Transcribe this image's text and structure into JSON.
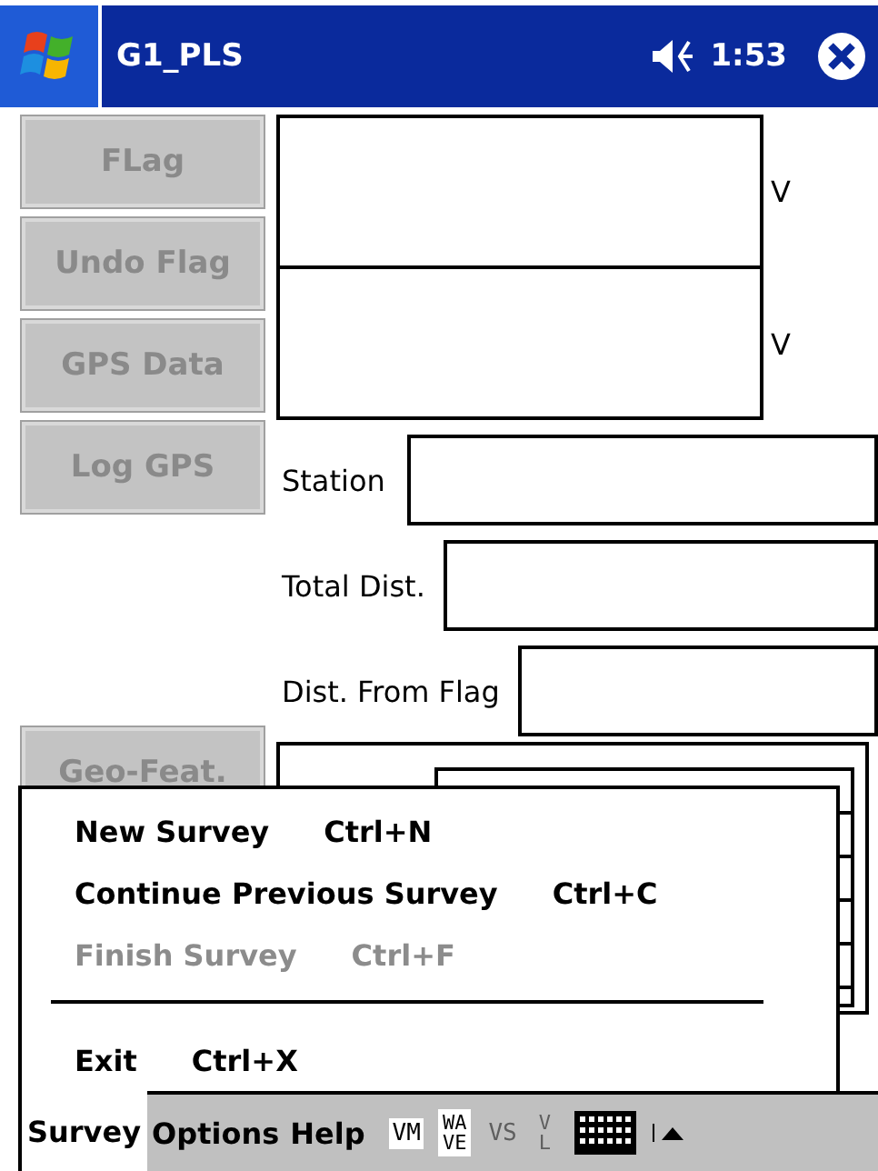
{
  "title_bar": {
    "title": "G1_PLS",
    "time": "1:53"
  },
  "side_buttons": [
    {
      "label": "FLag",
      "disabled": true
    },
    {
      "label": "Undo Flag",
      "disabled": true
    },
    {
      "label": "GPS Data",
      "disabled": true
    },
    {
      "label": "Log GPS",
      "disabled": true
    }
  ],
  "graphs": [
    {
      "unit": "V"
    },
    {
      "unit": "V"
    }
  ],
  "fields": [
    {
      "label": "Station"
    },
    {
      "label": "Total Dist."
    },
    {
      "label": "Dist. From Flag"
    }
  ],
  "geo_button": {
    "label": "Geo-Feat.",
    "disabled": true
  },
  "menu": {
    "items": [
      {
        "kind": "item",
        "label": "New Survey",
        "shortcut": "Ctrl+N",
        "disabled": false
      },
      {
        "kind": "item",
        "label": "Continue Previous Survey",
        "shortcut": "Ctrl+C",
        "disabled": false
      },
      {
        "kind": "item",
        "label": "Finish Survey",
        "shortcut": "Ctrl+F",
        "disabled": true
      },
      {
        "kind": "separator"
      },
      {
        "kind": "item",
        "label": "Exit",
        "shortcut": "Ctrl+X",
        "disabled": false
      }
    ]
  },
  "menu_bar": {
    "menus": [
      {
        "label": "Survey",
        "selected": true
      },
      {
        "label": "Options",
        "selected": false
      },
      {
        "label": "Help",
        "selected": false
      }
    ],
    "tools": [
      {
        "lines": [
          "VM"
        ],
        "disabled": false
      },
      {
        "lines": [
          "WA",
          "VE"
        ],
        "disabled": false
      },
      {
        "lines": [
          "VS"
        ],
        "disabled": true
      },
      {
        "lines": [
          "V",
          "L"
        ],
        "disabled": true
      }
    ]
  }
}
